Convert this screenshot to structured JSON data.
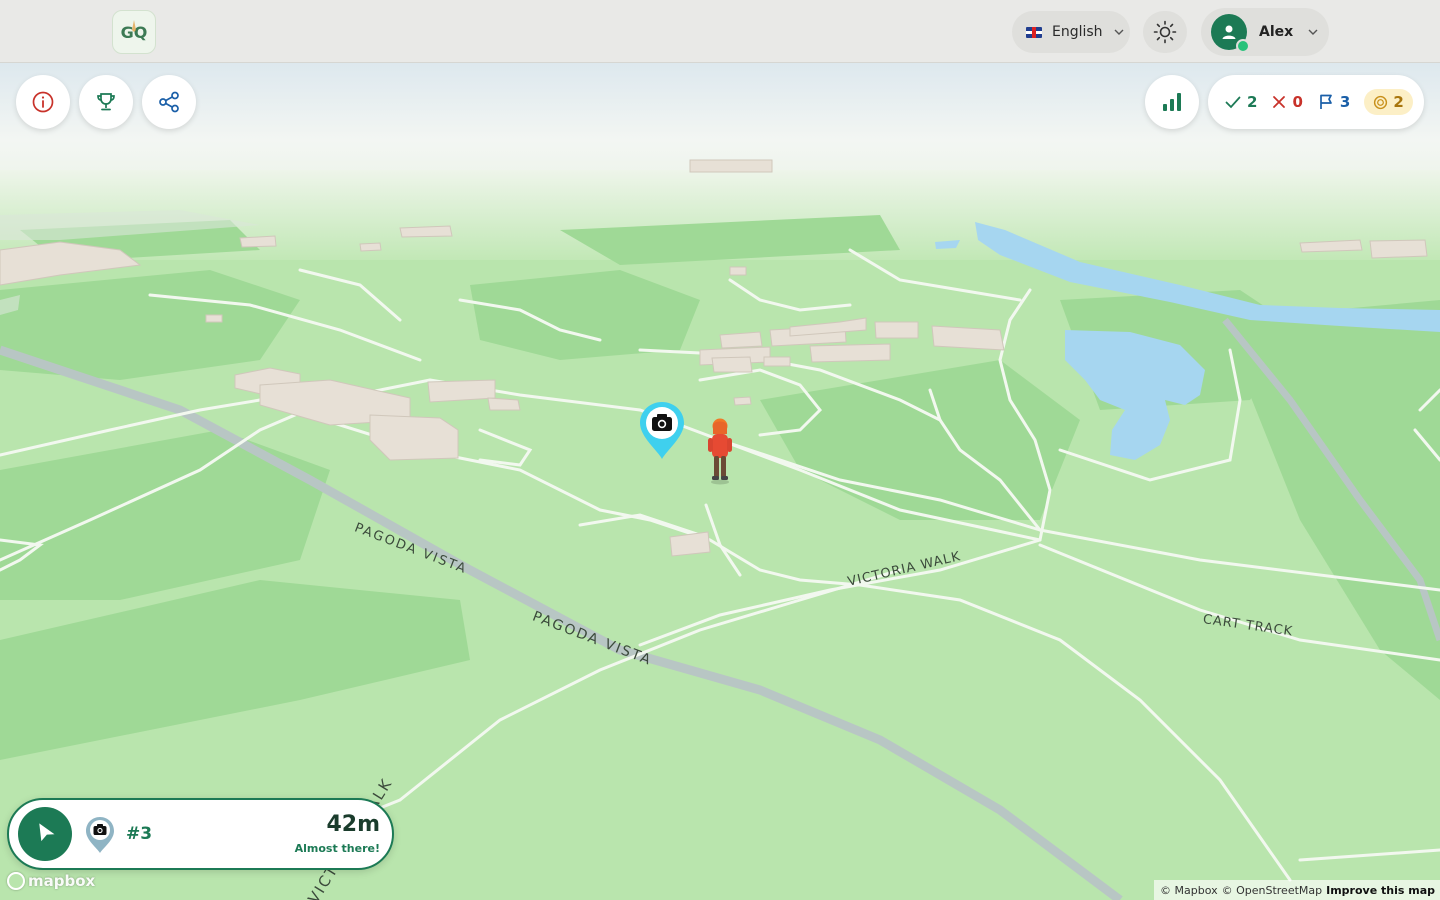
{
  "header": {
    "logo_text": "GQ",
    "language": {
      "label": "English",
      "flag": "uk-flag-icon"
    },
    "theme_icon": "sun-icon",
    "user": {
      "name": "Alex",
      "status": "online"
    }
  },
  "toolbar": {
    "left_buttons": [
      {
        "name": "info",
        "icon": "info-icon"
      },
      {
        "name": "leaderboard",
        "icon": "trophy-icon"
      },
      {
        "name": "share",
        "icon": "share-icon"
      }
    ],
    "stats_button_icon": "bar-chart-icon"
  },
  "stats": {
    "correct": "2",
    "wrong": "0",
    "flags": "3",
    "coins": "2"
  },
  "map": {
    "road_labels": [
      "PAGODA VISTA",
      "PAGODA VISTA",
      "VICTORIA WALK",
      "CART TRACK",
      "VICTORIA WALK"
    ],
    "marker_icon": "camera-icon"
  },
  "target": {
    "number": "#3",
    "distance": "42m",
    "status": "Almost there!"
  },
  "attribution": {
    "logo": "mapbox",
    "mapbox": "© Mapbox",
    "osm": "© OpenStreetMap",
    "improve": "Improve this map"
  },
  "colors": {
    "brand_green": "#1c7a55",
    "marker_cyan": "#3fd0ee",
    "water": "#a6d6f0",
    "grass": "#b9e5ad"
  }
}
